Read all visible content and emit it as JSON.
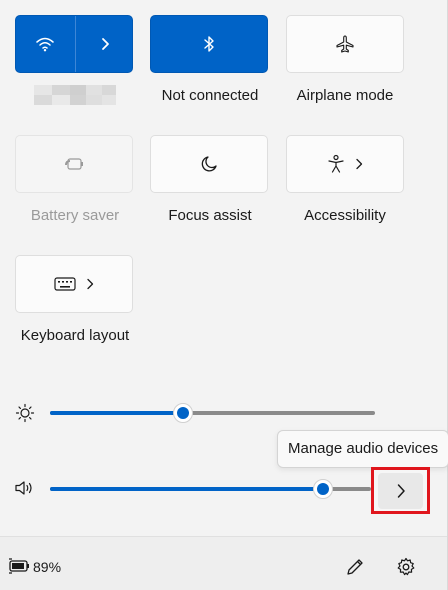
{
  "quick_settings": {
    "tiles": [
      {
        "label": "",
        "icon": "wifi-icon",
        "state": "on",
        "expand": "chevron-right-icon"
      },
      {
        "label": "Not connected",
        "icon": "bluetooth-icon",
        "state": "on"
      },
      {
        "label": "Airplane mode",
        "icon": "airplane-icon",
        "state": "off"
      },
      {
        "label": "Battery saver",
        "icon": "battery-saver-icon",
        "state": "disabled"
      },
      {
        "label": "Focus assist",
        "icon": "moon-icon",
        "state": "off"
      },
      {
        "label": "Accessibility",
        "icon": "accessibility-icon",
        "state": "off",
        "expand": "chevron-right-icon"
      },
      {
        "label": "Keyboard layout",
        "icon": "keyboard-icon",
        "state": "off",
        "expand": "chevron-right-icon"
      }
    ]
  },
  "sliders": {
    "brightness": {
      "icon": "brightness-icon",
      "value_fraction": 0.41
    },
    "volume": {
      "icon": "speaker-icon",
      "value_fraction": 0.85
    }
  },
  "tooltip": {
    "text": "Manage audio devices"
  },
  "audio_button": {
    "icon": "chevron-right-icon"
  },
  "footer": {
    "battery_icon": "battery-charging-icon",
    "battery_percent": "89%",
    "edit_icon": "pencil-icon",
    "settings_icon": "gear-icon"
  },
  "colors": {
    "accent": "#0063c7",
    "highlight_box": "#e0161d"
  }
}
